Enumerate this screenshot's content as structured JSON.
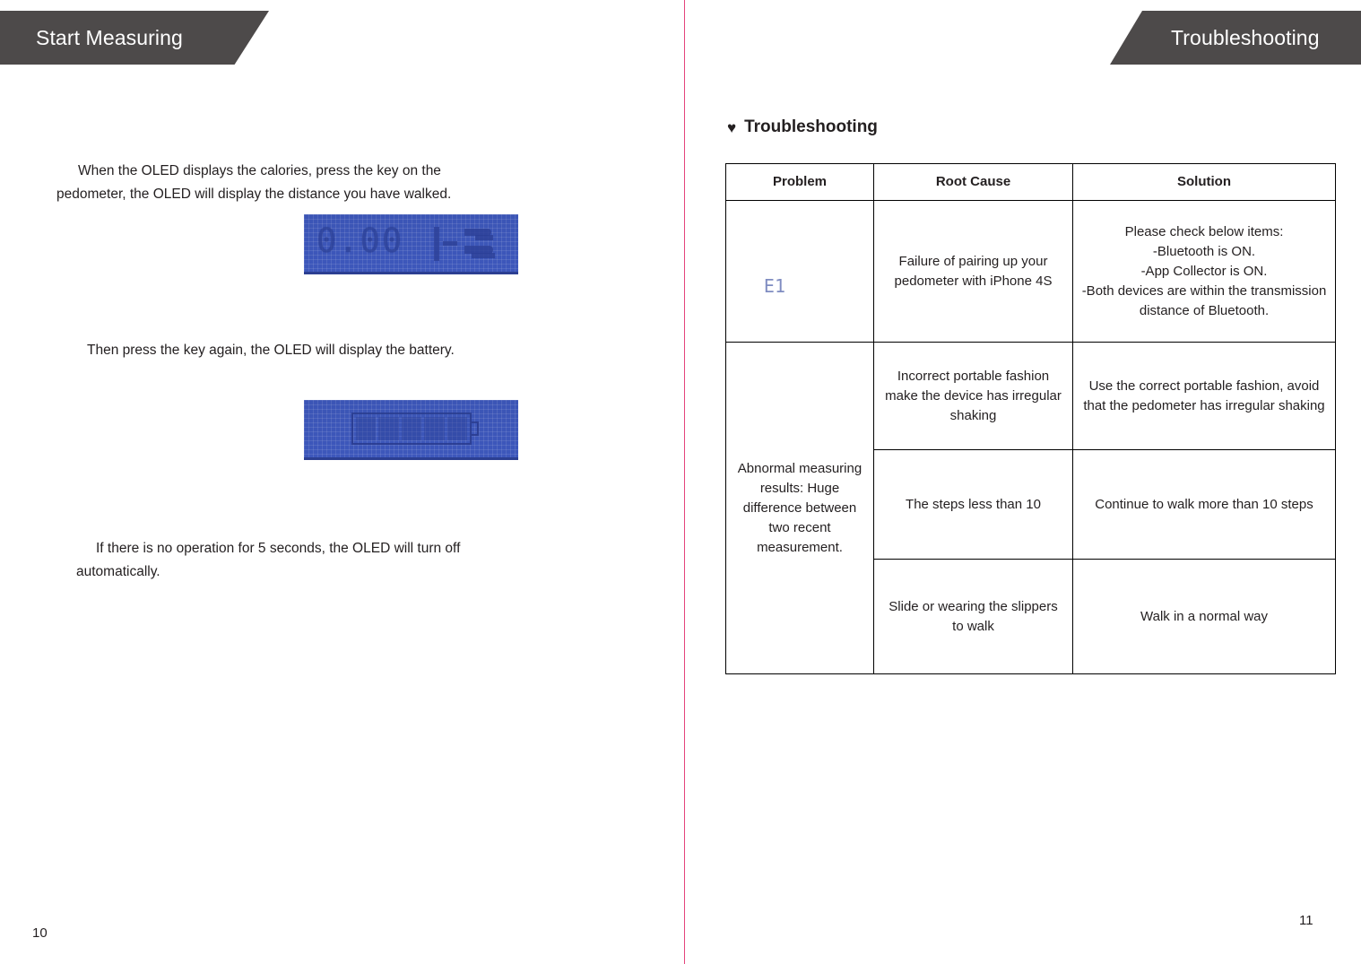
{
  "left_page": {
    "banner_title": "Start Measuring",
    "page_number": "10",
    "paragraphs": {
      "p1": "When the OLED displays the calories, press the key on the pedometer, the OLED will display the distance you have walked.",
      "p2": "Then press the key again, the OLED will display the battery.",
      "p3": "If there is no operation for 5 seconds, the OLED will turn off automatically."
    },
    "oled_distance": {
      "value": "0.00",
      "icon": "distance-shoe-icon"
    },
    "oled_battery": {
      "icon": "battery-icon",
      "segments": 5
    }
  },
  "right_page": {
    "banner_title": "Troubleshooting",
    "page_number": "11",
    "heading": {
      "bullet": "♥",
      "text": "Troubleshooting"
    },
    "table": {
      "headers": [
        "Problem",
        "Root Cause",
        "Solution"
      ],
      "rows": [
        {
          "problem_screen": "E1",
          "problem_text": "",
          "cause": "Failure of pairing up your pedometer with iPhone 4S",
          "solution": "Please check below items:\n-Bluetooth is ON.\n-App Collector is ON.\n-Both devices are within the transmission distance of Bluetooth."
        },
        {
          "problem_text": "Abnormal measuring results: Huge difference between two recent measurement.",
          "cause": "Incorrect portable fashion make the device has irregular shaking",
          "solution": "Use the correct portable fashion, avoid that the pedometer has irregular shaking"
        },
        {
          "problem_text": "",
          "cause": "The steps less than 10",
          "solution": "Continue to walk more than 10 steps"
        },
        {
          "problem_text": "",
          "cause": "Slide or wearing the slippers to walk",
          "solution": "Walk in a normal way"
        }
      ]
    }
  },
  "colors": {
    "banner": "#4d4a4a",
    "oled_blue": "#3d57bb",
    "oled_text": "#2b3f96",
    "gutter": "#e4447c",
    "text": "#231f20"
  }
}
